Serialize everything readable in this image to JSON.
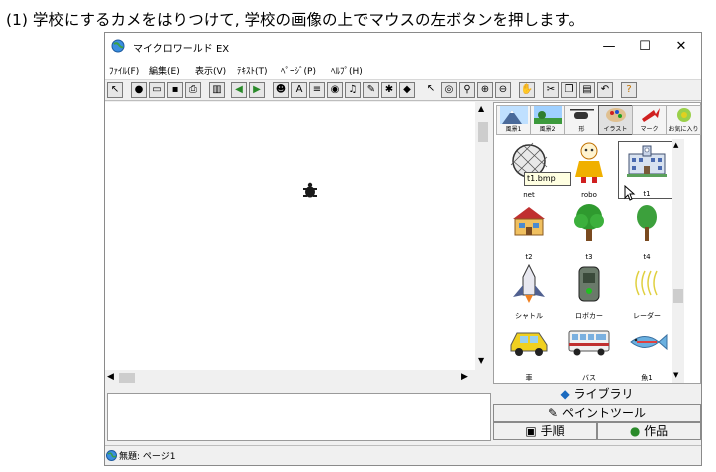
{
  "caption": "(1) 学校にするカメをはりつけて, 学校の画像の上でマウスの左ボタンを押します。",
  "window": {
    "title": "マイクロワールド EX",
    "minimize": "—",
    "maximize": "☐",
    "close": "✕"
  },
  "menu": [
    "ﾌｧｲﾙ(F)",
    "編集(E)",
    "表示(V)",
    "ﾃｷｽﾄ(T)",
    "ﾍﾟｰｼﾞ(P)",
    "ﾍﾙﾌﾟ(H)"
  ],
  "categories": [
    {
      "label": "風景1"
    },
    {
      "label": "風景2"
    },
    {
      "label": "形"
    },
    {
      "label": "イラスト",
      "selected": true
    },
    {
      "label": "マーク"
    },
    {
      "label": "お気に入り"
    }
  ],
  "shapes": [
    {
      "label": "net"
    },
    {
      "label": "robo"
    },
    {
      "label": "t1",
      "selected": true
    },
    {
      "label": "t2"
    },
    {
      "label": "t3"
    },
    {
      "label": "t4"
    },
    {
      "label": "シャトル"
    },
    {
      "label": "ロボカー"
    },
    {
      "label": "レーダー"
    },
    {
      "label": "車"
    },
    {
      "label": "バス"
    },
    {
      "label": "魚1"
    }
  ],
  "tooltip": "t1.bmp",
  "tabs": {
    "library": "ライブラリ",
    "paint": "ペイントツール",
    "procedure": "手順",
    "work": "作品"
  },
  "status": "無題: ページ1",
  "colors": {
    "turtle": "#1a1a1a",
    "tab_icon": "#1a6abf"
  }
}
